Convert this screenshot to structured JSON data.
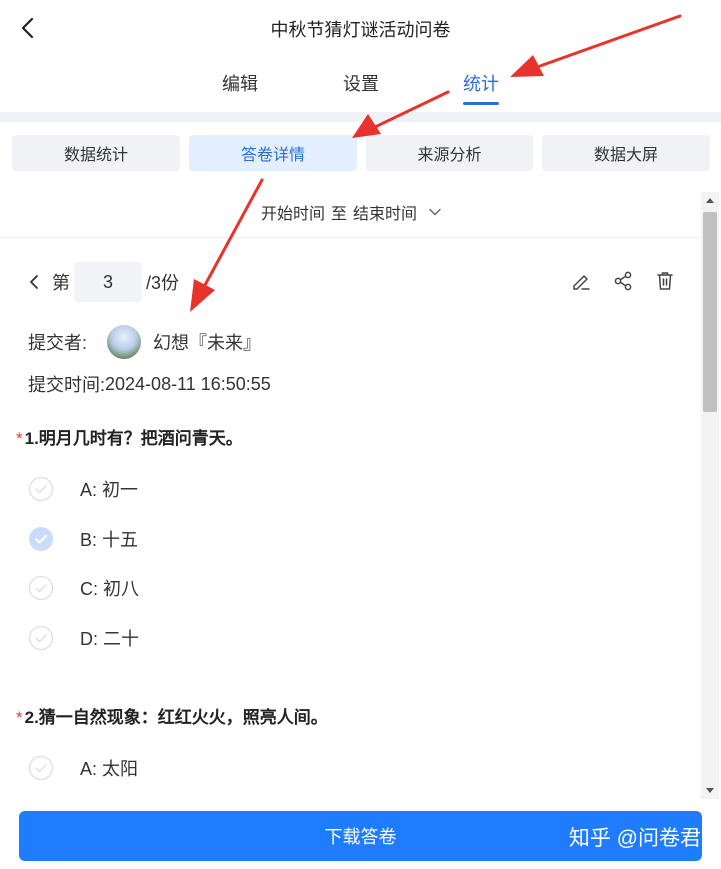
{
  "header": {
    "title": "中秋节猜灯谜活动问卷",
    "tabs": [
      {
        "label": "编辑"
      },
      {
        "label": "设置"
      },
      {
        "label": "统计"
      }
    ]
  },
  "subtabs": [
    {
      "label": "数据统计"
    },
    {
      "label": "答卷详情"
    },
    {
      "label": "来源分析"
    },
    {
      "label": "数据大屏"
    }
  ],
  "filter": {
    "start": "开始时间",
    "to": "至",
    "end": "结束时间"
  },
  "pager": {
    "prefix": "第",
    "current": "3",
    "suffix": "/3份"
  },
  "submitter": {
    "label": "提交者:",
    "name": "幻想『未来』",
    "time_label": "提交时间:",
    "time": "2024-08-11 16:50:55"
  },
  "questions": [
    {
      "required_mark": "*",
      "title": "1.明月几时有？把酒问青天。",
      "options": [
        {
          "label": "A: 初一",
          "selected": false
        },
        {
          "label": "B: 十五",
          "selected": true
        },
        {
          "label": "C: 初八",
          "selected": false
        },
        {
          "label": "D: 二十",
          "selected": false
        }
      ]
    },
    {
      "required_mark": "*",
      "title": "2.猜一自然现象：红红火火，照亮人间。",
      "options": [
        {
          "label": "A: 太阳",
          "selected": false
        }
      ]
    }
  ],
  "footer": {
    "download_label": "下载答卷",
    "watermark": "知乎 @问卷君"
  },
  "colors": {
    "accent": "#2a6fd6",
    "button": "#1f7cff",
    "required": "#e23b3b",
    "annotation": "#e8322c"
  }
}
